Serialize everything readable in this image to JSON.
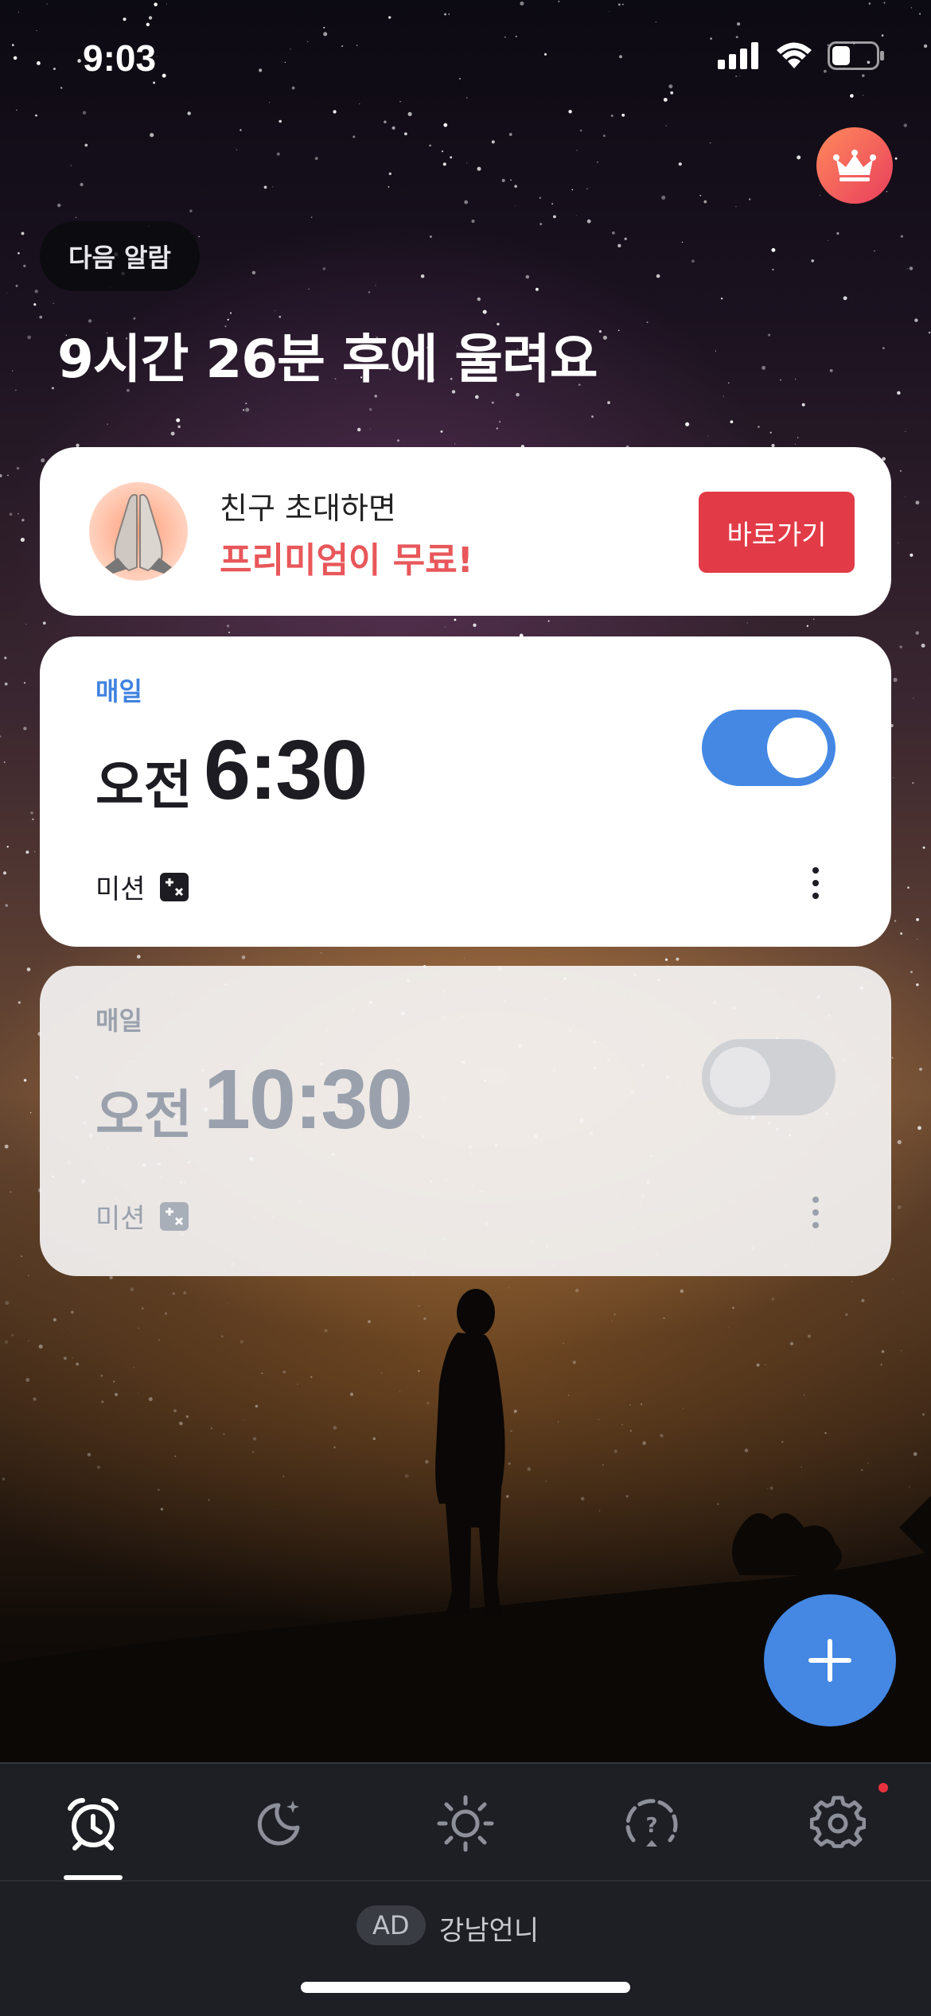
{
  "status_bar": {
    "time": "9:03"
  },
  "next_alarm": {
    "pill_label": "다음 알람",
    "headline": "9시간 26분 후에 울려요"
  },
  "promo": {
    "line1": "친구 초대하면",
    "line2": "프리미엄이 무료!",
    "button": "바로가기"
  },
  "alarms": [
    {
      "repeat": "매일",
      "ampm": "오전",
      "time": "6:30",
      "mission": "미션",
      "enabled": true
    },
    {
      "repeat": "매일",
      "ampm": "오전",
      "time": "10:30",
      "mission": "미션",
      "enabled": false
    }
  ],
  "tabs": [
    {
      "icon": "alarm-clock-icon",
      "active": true
    },
    {
      "icon": "moon-icon",
      "active": false
    },
    {
      "icon": "sun-icon",
      "active": false
    },
    {
      "icon": "question-gauge-icon",
      "active": false
    },
    {
      "icon": "gear-icon",
      "active": false,
      "badge": true
    }
  ],
  "ad": {
    "tag": "AD",
    "text": "강남언니"
  },
  "colors": {
    "accent": "#4488e4",
    "promo_button": "#e23b47",
    "crown_gradient": "#e83e5c"
  }
}
